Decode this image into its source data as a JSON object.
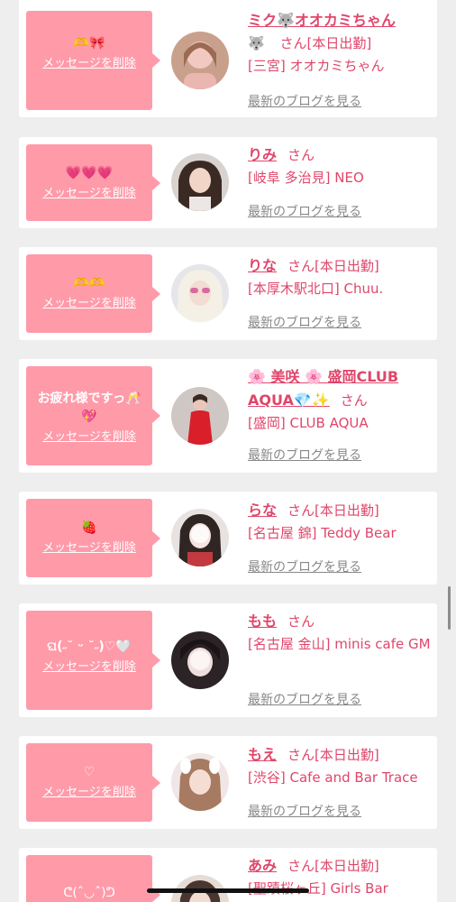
{
  "ui": {
    "delete_label": "メッセージを削除",
    "blog_label": "最新のブログを見る",
    "san": "さん"
  },
  "items": [
    {
      "message": "🫶🎀",
      "name": "ミク🐺オオカミちゃん",
      "name_suffix": "🐺",
      "shift": "[本日出勤]",
      "shop": "[三宮] オオカミちゃん"
    },
    {
      "message": "💗💗💗",
      "name": "りみ",
      "shift": "",
      "shop": "[岐阜 多治見] NEO"
    },
    {
      "message": "🫶🫶",
      "name": "りな",
      "shift": "[本日出勤]",
      "shop": "[本厚木駅北口] Chuu."
    },
    {
      "message": "お疲れ様ですっ🥂💖",
      "name": "🌸 美咲 🌸 盛岡CLUB AQUA💎✨",
      "shift": "",
      "shop": "[盛岡] CLUB AQUA"
    },
    {
      "message": "🍓",
      "name": "らな",
      "shift": "[本日出勤]",
      "shop": "[名古屋 錦] Teddy Bear"
    },
    {
      "message": "ଘ(˶˘ ᵕ ˘˶)♡🤍",
      "name": "もも",
      "shift": "",
      "shop": "[名古屋 金山] minis cafe GM"
    },
    {
      "message": "♡",
      "name": "もえ",
      "shift": "[本日出勤]",
      "shop": "[渋谷] Cafe and Bar Trace"
    },
    {
      "message": "ᕦ(ˆ◡ˆ)ᕤ",
      "name": "あみ",
      "shift": "[本日出勤]",
      "shop": "[聖蹟桜ヶ丘] Girls Bar"
    }
  ],
  "colors": {
    "accent": "#e0466b",
    "bubble": "#ff9aa9",
    "background": "#eeeeee"
  }
}
